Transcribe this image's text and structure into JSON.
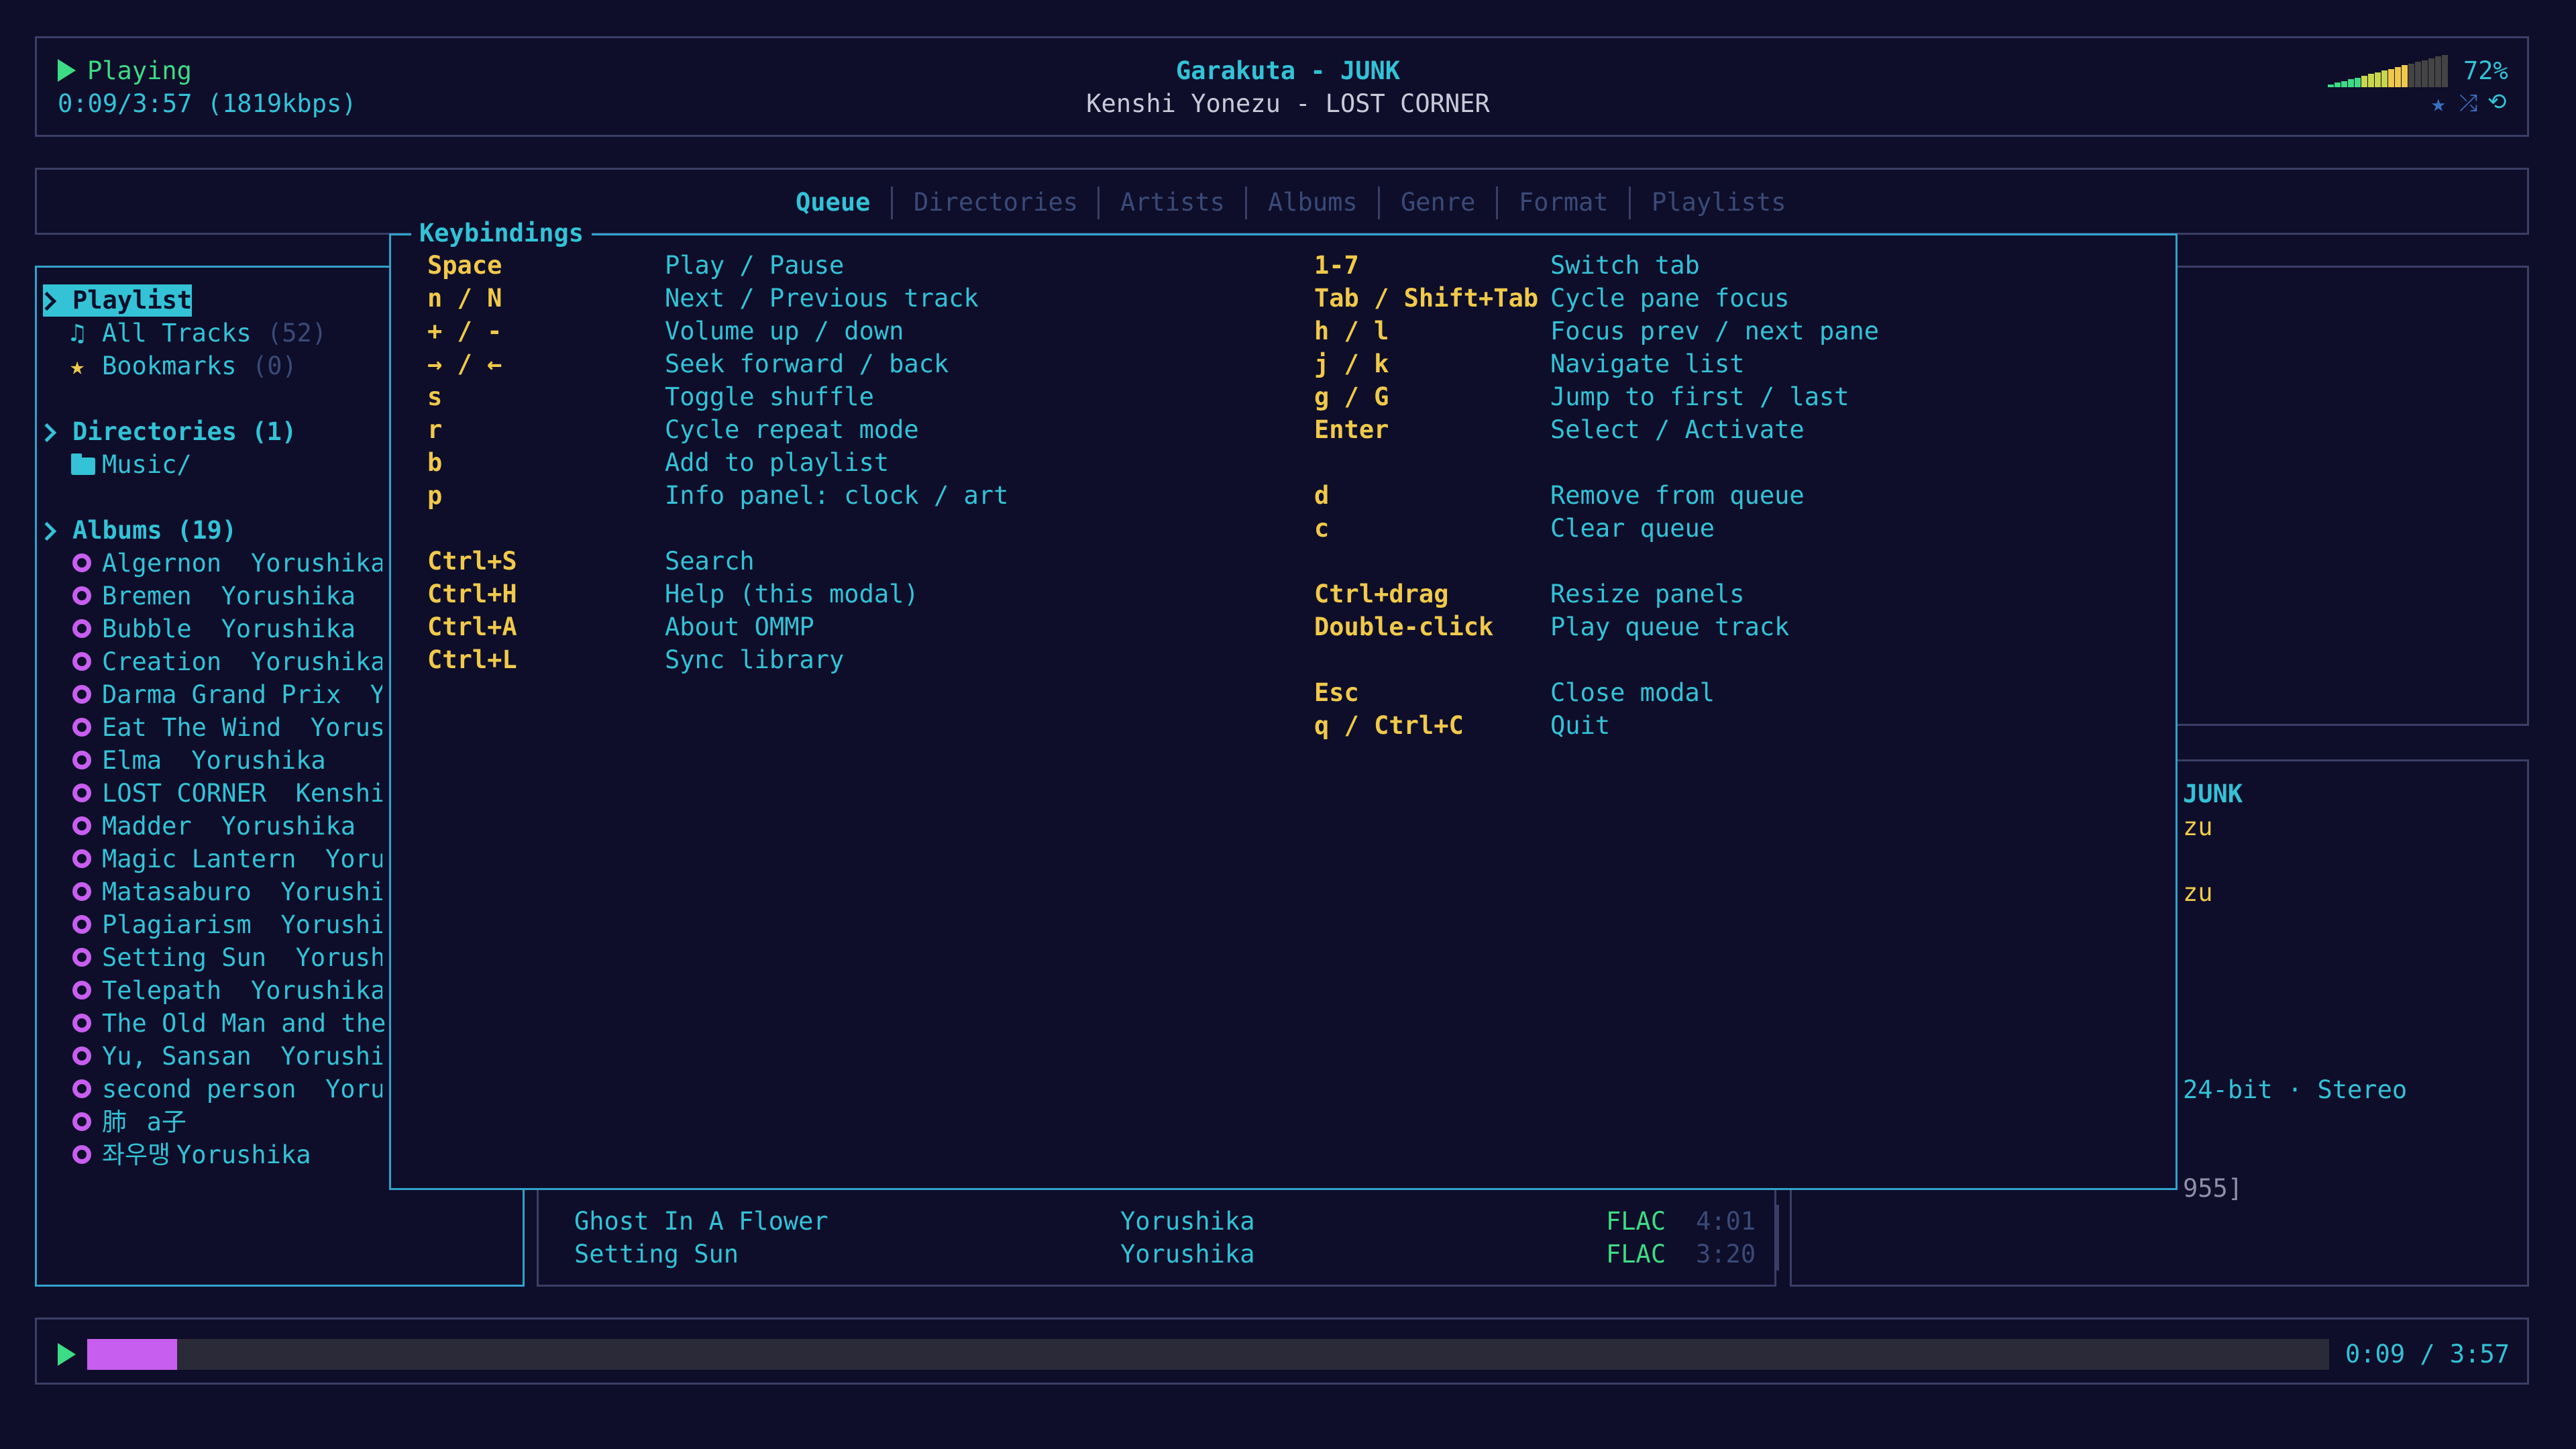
{
  "header": {
    "status": "Playing",
    "time": "0:09/3:57 (1819kbps)",
    "track_title": "Garakuta - JUNK",
    "track_subtitle": "Kenshi Yonezu - LOST CORNER",
    "volume": "72%",
    "volume_level": 0.72,
    "icons": [
      "star-icon",
      "shuffle-icon",
      "repeat-icon"
    ]
  },
  "tabs": [
    "Queue",
    "Directories",
    "Artists",
    "Albums",
    "Genre",
    "Format",
    "Playlists"
  ],
  "active_tab": "Queue",
  "sidebar": {
    "playlist_header": "Playlist",
    "playlist_items": [
      {
        "label": "All Tracks",
        "count": "(52)",
        "icon": "music-note-icon"
      },
      {
        "label": "Bookmarks",
        "count": "(0)",
        "icon": "star-icon"
      }
    ],
    "directories_header": "Directories (1)",
    "directories": [
      "Music/"
    ],
    "albums_header": "Albums (19)",
    "albums": [
      {
        "title": "Algernon",
        "artist": "Yorushika"
      },
      {
        "title": "Bremen",
        "artist": "Yorushika"
      },
      {
        "title": "Bubble",
        "artist": "Yorushika"
      },
      {
        "title": "Creation",
        "artist": "Yorushika"
      },
      {
        "title": "Darma Grand Prix",
        "artist": "Y"
      },
      {
        "title": "Eat The Wind",
        "artist": "Yorus"
      },
      {
        "title": "Elma",
        "artist": "Yorushika"
      },
      {
        "title": "LOST CORNER",
        "artist": "Kenshi"
      },
      {
        "title": "Madder",
        "artist": "Yorushika"
      },
      {
        "title": "Magic Lantern",
        "artist": "Yoru"
      },
      {
        "title": "Matasaburo",
        "artist": "Yorushi"
      },
      {
        "title": "Plagiarism",
        "artist": "Yorushi"
      },
      {
        "title": "Setting Sun",
        "artist": "Yorush"
      },
      {
        "title": "Telepath",
        "artist": "Yorushika"
      },
      {
        "title": "The Old Man and the",
        "artist": ""
      },
      {
        "title": "Yu, Sansan",
        "artist": "Yorushi"
      },
      {
        "title": "second person",
        "artist": "Yoru"
      },
      {
        "title": "肺",
        "artist": "a子"
      },
      {
        "title": "좌우맹",
        "artist": "Yorushika"
      }
    ]
  },
  "queue_rows": [
    {
      "title": "Ghost In A Flower",
      "artist": "Yorushika",
      "format": "FLAC",
      "duration": "4:01"
    },
    {
      "title": "Setting Sun",
      "artist": "Yorushika",
      "format": "FLAC",
      "duration": "3:20"
    }
  ],
  "info_panel": {
    "title_fragment": "JUNK",
    "line1": "zu",
    "line2": "zu",
    "format_line": "24-bit · Stereo",
    "tail": "955]"
  },
  "modal": {
    "title": "Keybindings",
    "left": [
      {
        "key": "Space",
        "desc": "Play / Pause"
      },
      {
        "key": "n / N",
        "desc": "Next / Previous track"
      },
      {
        "key": "+ / -",
        "desc": "Volume up / down"
      },
      {
        "key": "→ / ←",
        "desc": "Seek forward / back"
      },
      {
        "key": "s",
        "desc": "Toggle shuffle"
      },
      {
        "key": "r",
        "desc": "Cycle repeat mode"
      },
      {
        "key": "b",
        "desc": "Add to playlist"
      },
      {
        "key": "p",
        "desc": "Info panel: clock / art"
      },
      {
        "key": "",
        "desc": ""
      },
      {
        "key": "Ctrl+S",
        "desc": "Search"
      },
      {
        "key": "Ctrl+H",
        "desc": "Help (this modal)"
      },
      {
        "key": "Ctrl+A",
        "desc": "About OMMP"
      },
      {
        "key": "Ctrl+L",
        "desc": "Sync library"
      }
    ],
    "right": [
      {
        "key": "1-7",
        "desc": "Switch tab"
      },
      {
        "key": "Tab / Shift+Tab",
        "desc": "Cycle pane focus"
      },
      {
        "key": "h / l",
        "desc": "Focus prev / next pane"
      },
      {
        "key": "j / k",
        "desc": "Navigate list"
      },
      {
        "key": "g / G",
        "desc": "Jump to first / last"
      },
      {
        "key": "Enter",
        "desc": "Select / Activate"
      },
      {
        "key": "",
        "desc": ""
      },
      {
        "key": "d",
        "desc": "Remove from queue"
      },
      {
        "key": "c",
        "desc": "Clear queue"
      },
      {
        "key": "",
        "desc": ""
      },
      {
        "key": "Ctrl+drag",
        "desc": "Resize panels"
      },
      {
        "key": "Double-click",
        "desc": "Play queue track"
      },
      {
        "key": "",
        "desc": ""
      },
      {
        "key": "Esc",
        "desc": "Close modal"
      },
      {
        "key": "q / Ctrl+C",
        "desc": "Quit"
      }
    ]
  },
  "progress": {
    "fraction": 0.04,
    "time": "0:09 / 3:57"
  },
  "colors": {
    "background": "#0e0e2a",
    "cyan": "#33c2d6",
    "yellow": "#f0c94a",
    "green": "#3ddc84",
    "magenta": "#c85ef0",
    "border": "#3b3f66"
  }
}
